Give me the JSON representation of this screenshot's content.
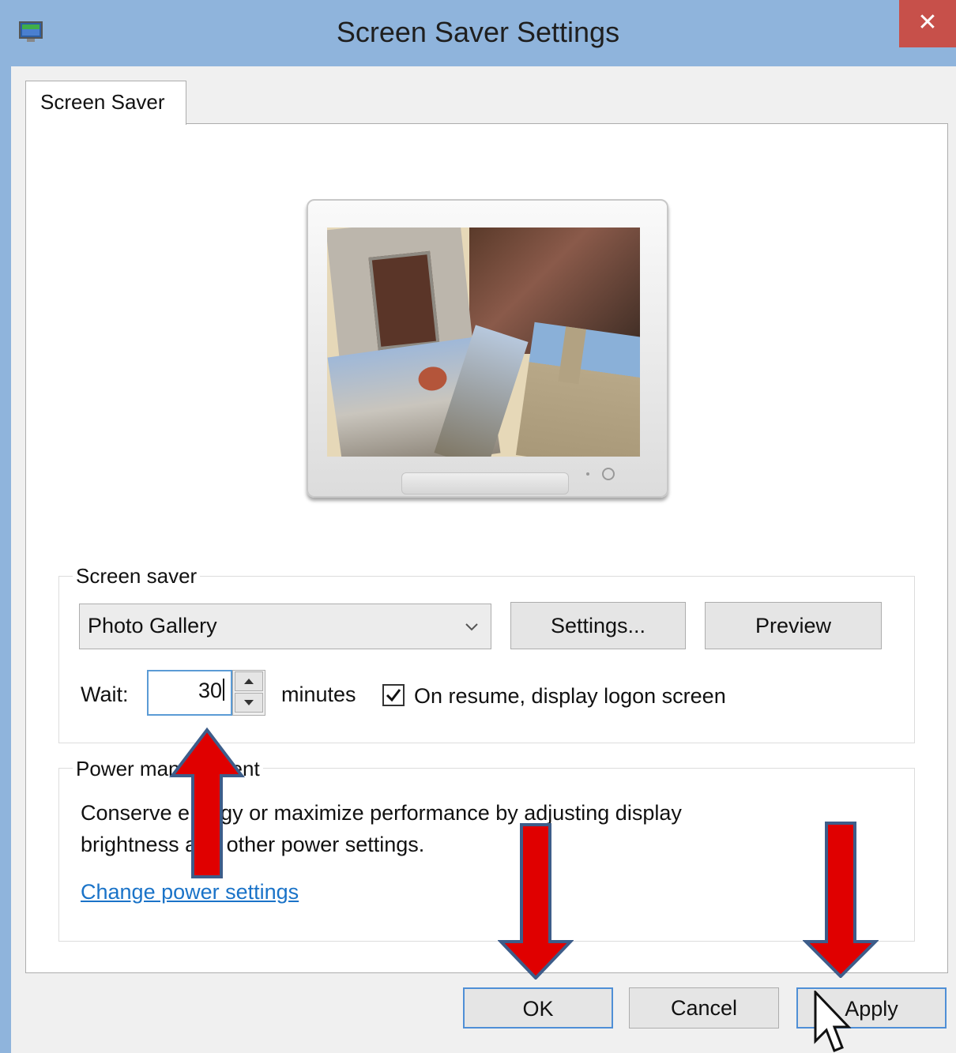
{
  "window": {
    "title": "Screen Saver Settings",
    "close_label": "✕"
  },
  "tabs": [
    {
      "label": "Screen Saver"
    }
  ],
  "screen_saver": {
    "group_label": "Screen saver",
    "selected": "Photo Gallery",
    "settings_button": "Settings...",
    "preview_button": "Preview",
    "wait_label": "Wait:",
    "wait_value": "30",
    "minutes_label": "minutes",
    "resume_checked": true,
    "resume_label": "On resume, display logon screen"
  },
  "power": {
    "group_label": "Power management",
    "description_line1": "Conserve energy or maximize performance by adjusting display",
    "description_line2": "brightness and other power settings.",
    "link": "Change power settings"
  },
  "footer": {
    "ok": "OK",
    "cancel": "Cancel",
    "apply": "Apply"
  },
  "colors": {
    "titlebar": "#8fb4dc",
    "close": "#c7504a",
    "link": "#1a73c8",
    "annotation_arrow": "#e00000"
  },
  "icons": [
    "app-monitor-icon",
    "close-icon",
    "chevron-down-icon",
    "spin-up-icon",
    "spin-down-icon",
    "checkmark-icon",
    "mouse-cursor-icon"
  ]
}
